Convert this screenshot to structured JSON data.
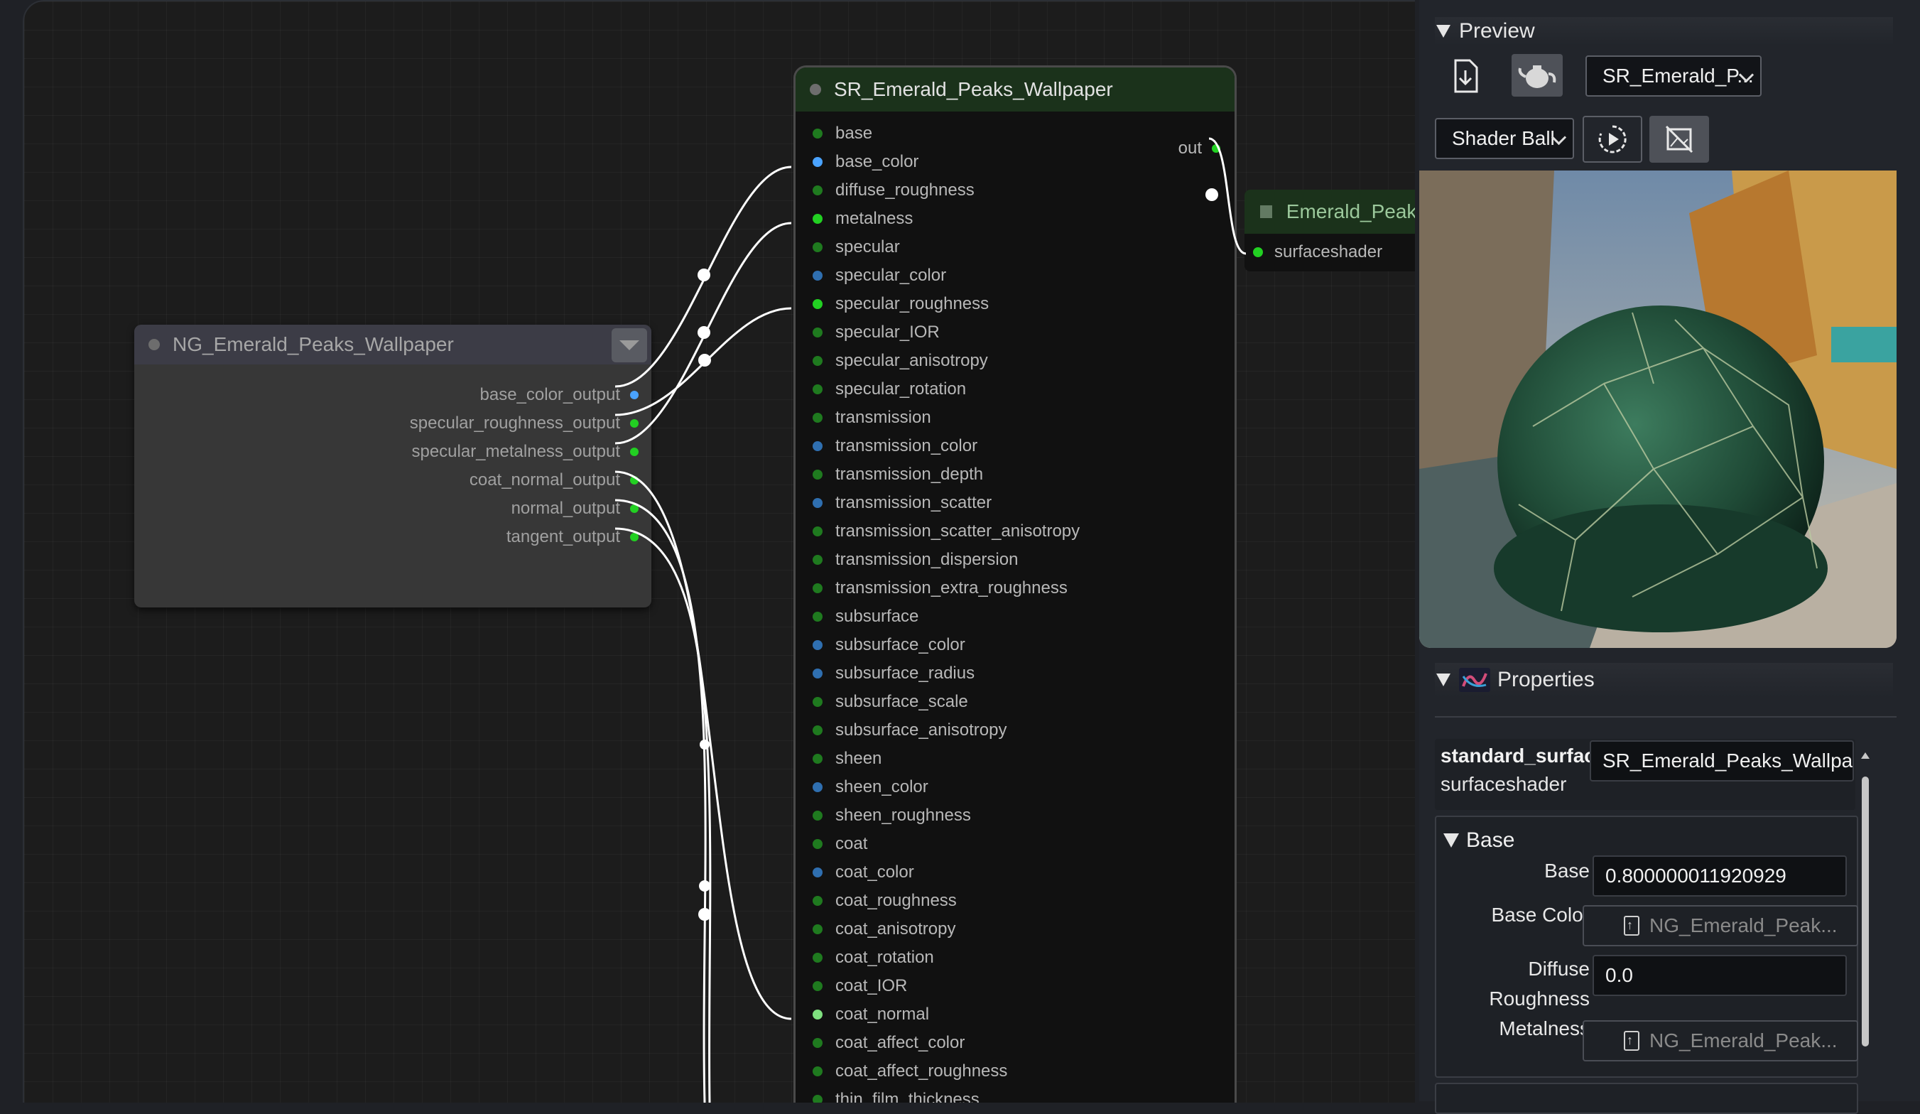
{
  "graph": {
    "ng_node": {
      "title": "NG_Emerald_Peaks_Wallpaper",
      "outputs": [
        {
          "label": "base_color_output",
          "color": "#4aa3ff"
        },
        {
          "label": "specular_roughness_output",
          "color": "#22d022"
        },
        {
          "label": "specular_metalness_output",
          "color": "#22d022"
        },
        {
          "label": "coat_normal_output",
          "color": "#22d022"
        },
        {
          "label": "normal_output",
          "color": "#22d022"
        },
        {
          "label": "tangent_output",
          "color": "#22d022"
        }
      ]
    },
    "sr_node": {
      "title": "SR_Emerald_Peaks_Wallpaper",
      "output_label": "out",
      "inputs": [
        {
          "label": "base",
          "color": "#1f7a1f"
        },
        {
          "label": "base_color",
          "color": "#4aa3ff"
        },
        {
          "label": "diffuse_roughness",
          "color": "#1f7a1f"
        },
        {
          "label": "metalness",
          "color": "#22d022"
        },
        {
          "label": "specular",
          "color": "#1f7a1f"
        },
        {
          "label": "specular_color",
          "color": "#2f6fb0"
        },
        {
          "label": "specular_roughness",
          "color": "#22d022"
        },
        {
          "label": "specular_IOR",
          "color": "#1f7a1f"
        },
        {
          "label": "specular_anisotropy",
          "color": "#1f7a1f"
        },
        {
          "label": "specular_rotation",
          "color": "#1f7a1f"
        },
        {
          "label": "transmission",
          "color": "#1f7a1f"
        },
        {
          "label": "transmission_color",
          "color": "#2f6fb0"
        },
        {
          "label": "transmission_depth",
          "color": "#1f7a1f"
        },
        {
          "label": "transmission_scatter",
          "color": "#2f6fb0"
        },
        {
          "label": "transmission_scatter_anisotropy",
          "color": "#1f7a1f"
        },
        {
          "label": "transmission_dispersion",
          "color": "#1f7a1f"
        },
        {
          "label": "transmission_extra_roughness",
          "color": "#1f7a1f"
        },
        {
          "label": "subsurface",
          "color": "#1f7a1f"
        },
        {
          "label": "subsurface_color",
          "color": "#2f6fb0"
        },
        {
          "label": "subsurface_radius",
          "color": "#2f6fb0"
        },
        {
          "label": "subsurface_scale",
          "color": "#1f7a1f"
        },
        {
          "label": "subsurface_anisotropy",
          "color": "#1f7a1f"
        },
        {
          "label": "sheen",
          "color": "#1f7a1f"
        },
        {
          "label": "sheen_color",
          "color": "#2f6fb0"
        },
        {
          "label": "sheen_roughness",
          "color": "#1f7a1f"
        },
        {
          "label": "coat",
          "color": "#1f7a1f"
        },
        {
          "label": "coat_color",
          "color": "#2f6fb0"
        },
        {
          "label": "coat_roughness",
          "color": "#1f7a1f"
        },
        {
          "label": "coat_anisotropy",
          "color": "#1f7a1f"
        },
        {
          "label": "coat_rotation",
          "color": "#1f7a1f"
        },
        {
          "label": "coat_IOR",
          "color": "#1f7a1f"
        },
        {
          "label": "coat_normal",
          "color": "#7fe07f"
        },
        {
          "label": "coat_affect_color",
          "color": "#1f7a1f"
        },
        {
          "label": "coat_affect_roughness",
          "color": "#1f7a1f"
        },
        {
          "label": "thin_film_thickness",
          "color": "#1f7a1f"
        }
      ]
    },
    "material_node": {
      "title": "Emerald_Peaks_",
      "input_label": "surfaceshader"
    }
  },
  "panel": {
    "preview": {
      "header": "Preview",
      "material_select": "SR_Emerald_P...",
      "geometry_select": "Shader Ball",
      "icons": [
        "download-icon",
        "teapot-icon",
        "refresh-play-icon",
        "no-image-icon"
      ]
    },
    "properties": {
      "header": "Properties",
      "node_type": "standard_surfac",
      "node_name": "SR_Emerald_Peaks_Wallpa",
      "output_type": "surfaceshader",
      "group_header": "Base",
      "rows": {
        "base_label": "Base",
        "base_value": "0.800000011920929",
        "base_color_label": "Base Color",
        "base_color_value": "NG_Emerald_Peak...",
        "diffuse_roughness_label_1": "Diffuse",
        "diffuse_roughness_label_2": "Roughness",
        "diffuse_roughness_value": "0.0",
        "metalness_label": "Metalness",
        "metalness_value": "NG_Emerald_Peak..."
      }
    }
  }
}
